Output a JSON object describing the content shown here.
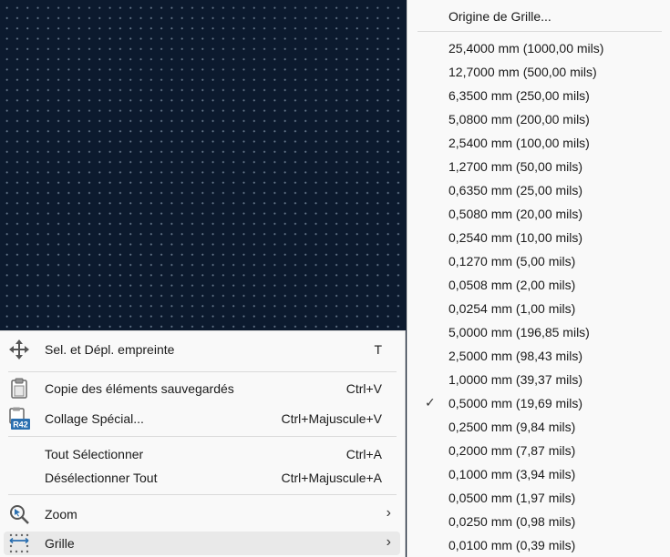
{
  "context_menu": {
    "items": [
      {
        "label": "Sel. et Dépl. empreinte",
        "shortcut": "T",
        "icon": "move-icon"
      },
      {
        "label": "Copie des éléments sauvegardés",
        "shortcut": "Ctrl+V",
        "icon": "paste-icon"
      },
      {
        "label": "Collage Spécial...",
        "shortcut": "Ctrl+Majuscule+V",
        "icon": "paste-special-icon",
        "icon_text": "R42"
      },
      {
        "label": "Tout Sélectionner",
        "shortcut": "Ctrl+A"
      },
      {
        "label": "Désélectionner Tout",
        "shortcut": "Ctrl+Majuscule+A"
      },
      {
        "label": "Zoom",
        "submenu_arrow": "›",
        "icon": "zoom-icon"
      },
      {
        "label": "Grille",
        "submenu_arrow": "›",
        "icon": "grid-icon",
        "highlighted": true
      }
    ]
  },
  "grid_submenu": {
    "origin_label": "Origine de Grille...",
    "selected_check": "✓",
    "items": [
      "25,4000 mm (1000,00 mils)",
      "12,7000 mm (500,00 mils)",
      "6,3500 mm (250,00 mils)",
      "5,0800 mm (200,00 mils)",
      "2,5400 mm (100,00 mils)",
      "1,2700 mm (50,00 mils)",
      "0,6350 mm (25,00 mils)",
      "0,5080 mm (20,00 mils)",
      "0,2540 mm (10,00 mils)",
      "0,1270 mm (5,00 mils)",
      "0,0508 mm (2,00 mils)",
      "0,0254 mm (1,00 mils)",
      "5,0000 mm (196,85 mils)",
      "2,5000 mm (98,43 mils)",
      "1,0000 mm (39,37 mils)",
      "0,5000 mm (19,69 mils)",
      "0,2500 mm (9,84 mils)",
      "0,2000 mm (7,87 mils)",
      "0,1000 mm (3,94 mils)",
      "0,0500 mm (1,97 mils)",
      "0,0250 mm (0,98 mils)",
      "0,0100 mm (0,39 mils)"
    ],
    "selected_index": 15
  },
  "colors": {
    "canvas_background": "#0c1a2e",
    "menu_background": "#f9f9f9",
    "icon_blue": "#2a6fb0"
  }
}
